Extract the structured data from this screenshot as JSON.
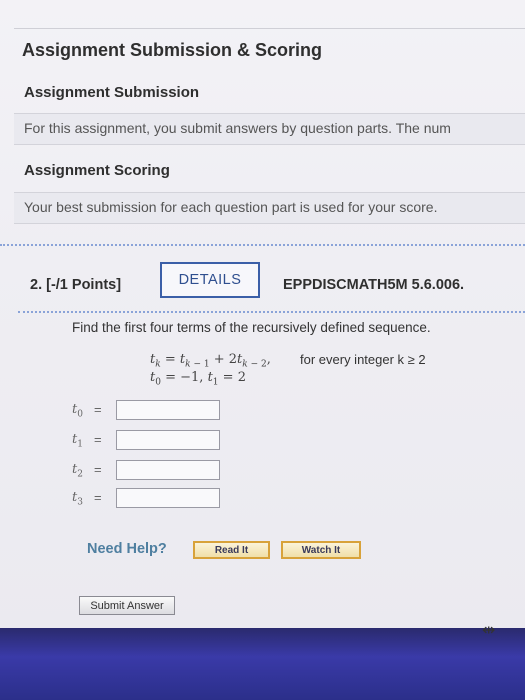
{
  "header": {
    "title": "Assignment Submission & Scoring"
  },
  "submission": {
    "heading": "Assignment Submission",
    "text": "For this assignment, you submit answers by question parts. The num"
  },
  "scoring": {
    "heading": "Assignment Scoring",
    "text": "Your best submission for each question part is used for your score."
  },
  "question": {
    "number_label": "2. [-/1 Points]",
    "details_label": "DETAILS",
    "code": "EPPDISCMATH5M 5.6.006.",
    "prompt": "Find the first four terms of the recursively defined sequence.",
    "condition": "for every integer k ≥ 2",
    "answers": [
      {
        "var": "t",
        "sub": "0",
        "value": ""
      },
      {
        "var": "t",
        "sub": "1",
        "value": ""
      },
      {
        "var": "t",
        "sub": "2",
        "value": ""
      },
      {
        "var": "t",
        "sub": "3",
        "value": ""
      }
    ]
  },
  "help": {
    "label": "Need Help?",
    "read_label": "Read It",
    "watch_label": "Watch It"
  },
  "submit": {
    "label": "Submit Answer"
  }
}
